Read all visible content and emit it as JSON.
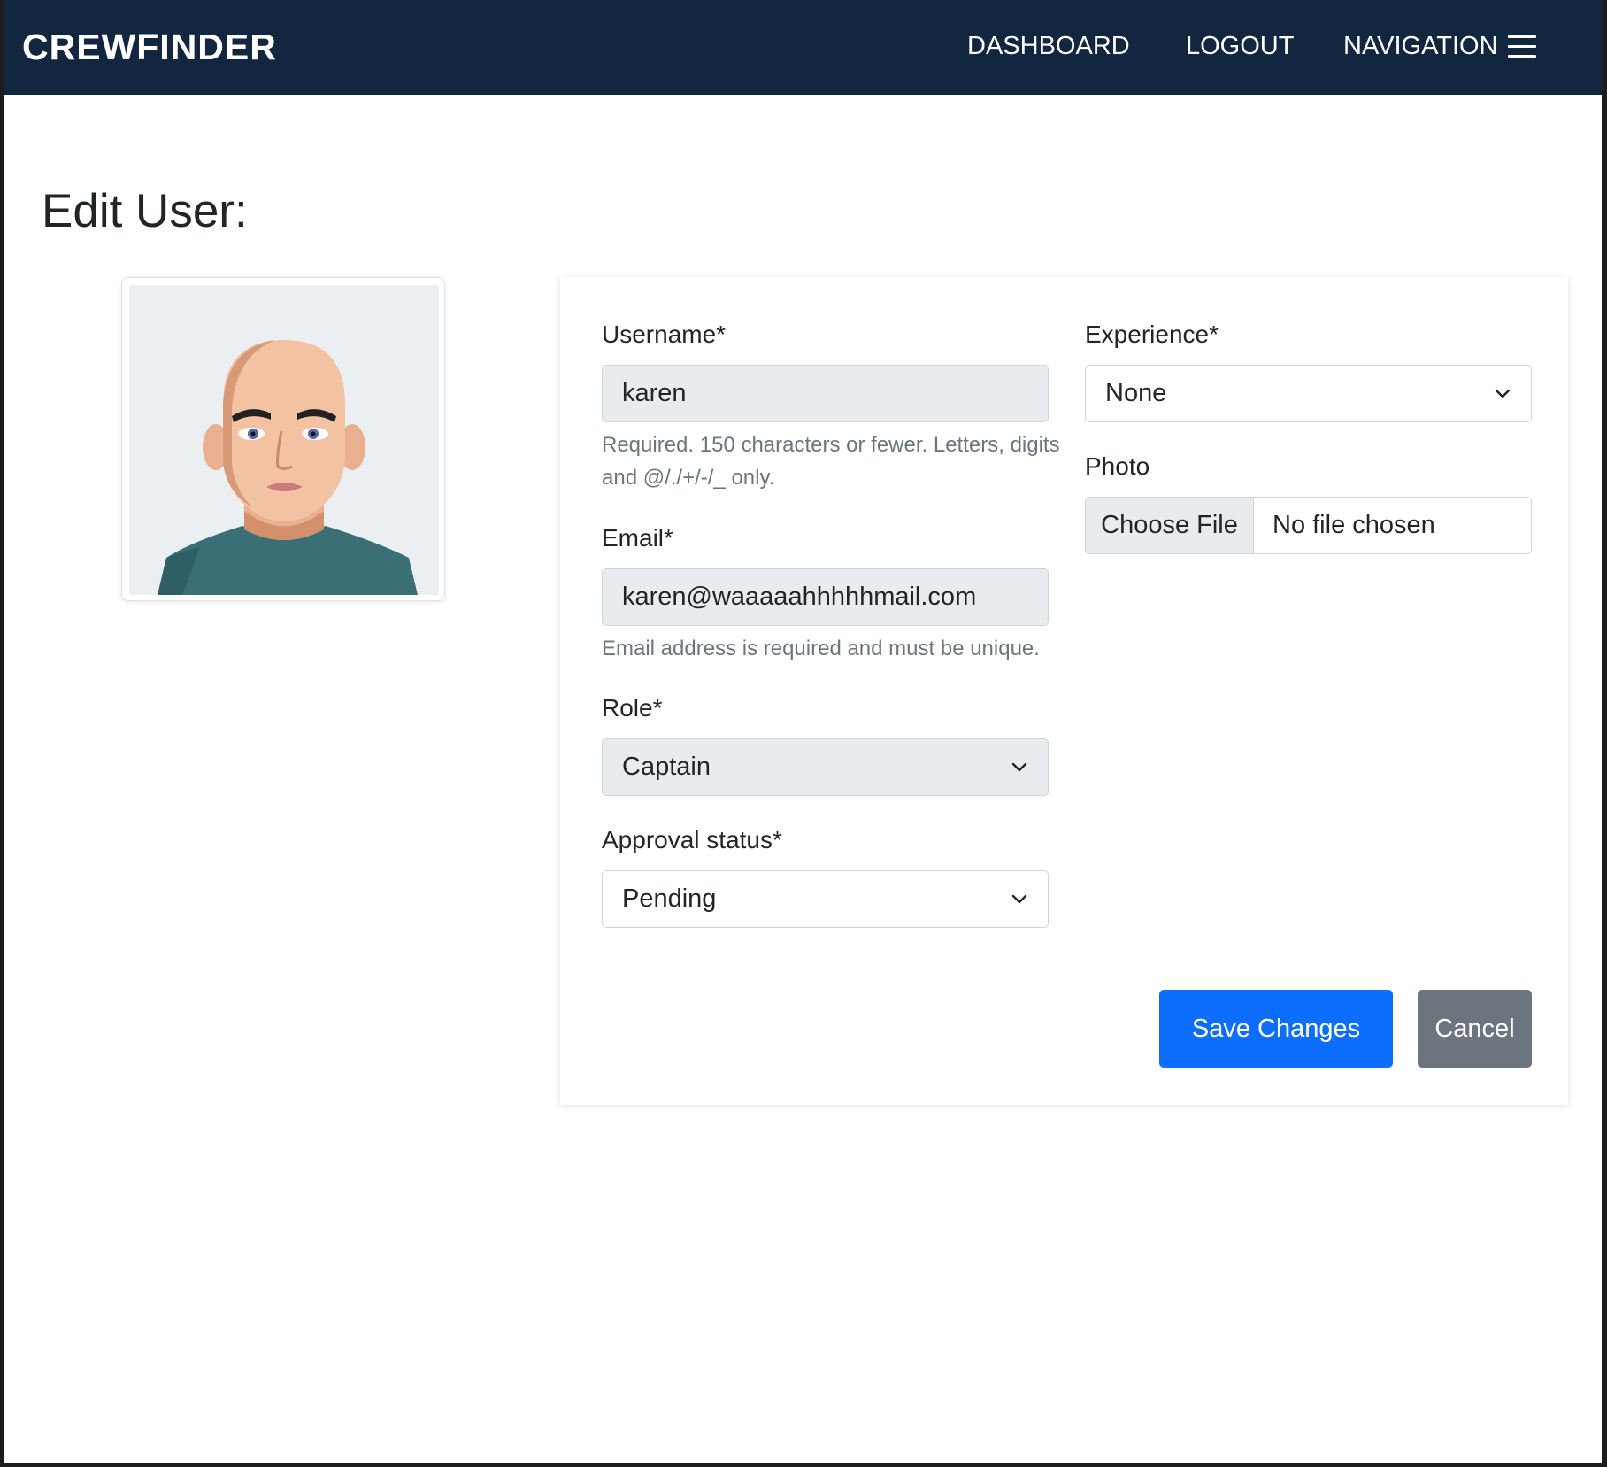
{
  "navbar": {
    "brand": "CREWFINDER",
    "links": {
      "dashboard": "DASHBOARD",
      "logout": "LOGOUT",
      "navigation": "NAVIGATION"
    },
    "menu_icon": "hamburger-menu-icon",
    "background_color": "#13263f"
  },
  "page": {
    "title": "Edit User:"
  },
  "avatar": {
    "icon": "cartoon-user-avatar"
  },
  "form": {
    "username": {
      "label": "Username*",
      "value": "karen",
      "help": "Required. 150 characters or fewer. Letters, digits and @/./+/-/_ only."
    },
    "email": {
      "label": "Email*",
      "value": "karen@waaaaahhhhhmail.com",
      "help": "Email address is required and must be unique."
    },
    "role": {
      "label": "Role*",
      "value": "Captain"
    },
    "approval_status": {
      "label": "Approval status*",
      "value": "Pending"
    },
    "experience": {
      "label": "Experience*",
      "value": "None"
    },
    "photo": {
      "label": "Photo",
      "button_label": "Choose File",
      "status": "No file chosen"
    },
    "buttons": {
      "save_label": "Save Changes",
      "cancel_label": "Cancel"
    }
  },
  "colors": {
    "primary": "#0d6efd",
    "secondary": "#6c757d",
    "disabled_field": "#e9ecef"
  }
}
